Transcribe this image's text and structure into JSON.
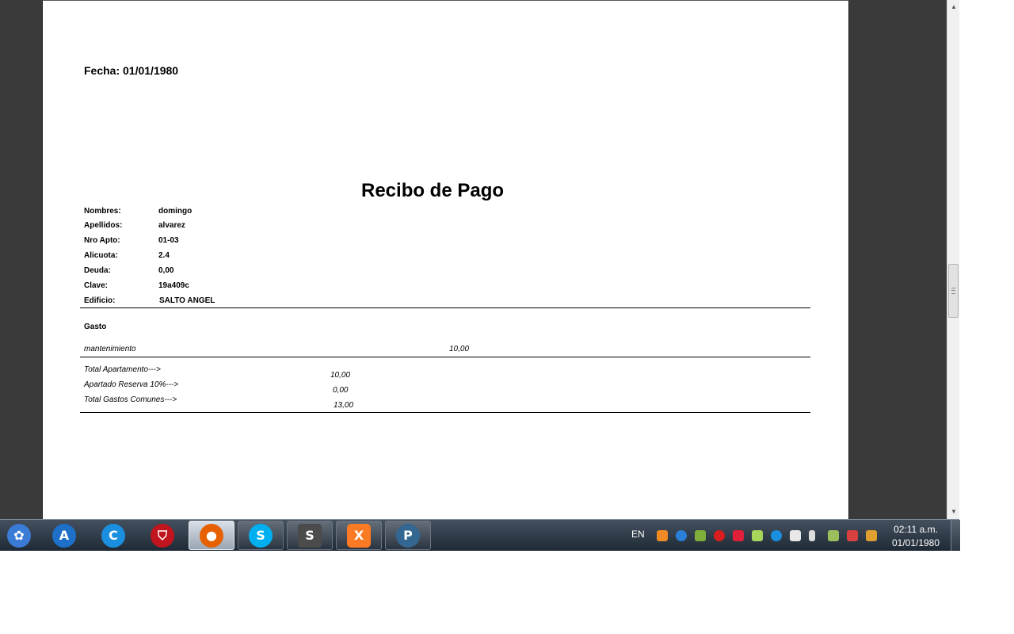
{
  "receipt": {
    "date_line": "Fecha: 01/01/1980",
    "title": "Recibo de Pago",
    "fields": [
      {
        "label": "Nombres:",
        "value": "domingo"
      },
      {
        "label": "Apellidos:",
        "value": "alvarez"
      },
      {
        "label": "Nro Apto:",
        "value": "01-03"
      },
      {
        "label": "Alicuota:",
        "value": "2.4"
      },
      {
        "label": "Deuda:",
        "value": "0,00"
      },
      {
        "label": "Clave:",
        "value": "19a409c"
      },
      {
        "label": "Edificio:",
        "value": "SALTO ANGEL"
      }
    ],
    "gasto_header": "Gasto",
    "gasto_item": {
      "name": "mantenimiento",
      "amount": "10,00"
    },
    "totals": [
      {
        "label": "Total Apartamento--->",
        "value": "10,00"
      },
      {
        "label": "Apartado Reserva 10%--->",
        "value": "0,00"
      },
      {
        "label": "Total Gastos Comunes--->",
        "value": "13,00"
      }
    ]
  },
  "taskbar": {
    "apps": [
      {
        "name": "start",
        "icon": "paint-palette-icon",
        "color": "#3a7bd5"
      },
      {
        "name": "avast",
        "icon": "avast-icon",
        "color": "#1e6fc8"
      },
      {
        "name": "ccleaner",
        "icon": "ccleaner-icon",
        "color": "#1a8fe0"
      },
      {
        "name": "security",
        "icon": "shield-icon",
        "color": "#c0141e"
      },
      {
        "name": "firefox",
        "icon": "firefox-icon",
        "color": "#e66000"
      },
      {
        "name": "skype",
        "icon": "skype-icon",
        "color": "#00aff0"
      },
      {
        "name": "sublime",
        "icon": "sublime-icon",
        "color": "#4b4b4b"
      },
      {
        "name": "xampp",
        "icon": "xampp-icon",
        "color": "#fb7a24"
      },
      {
        "name": "postgres",
        "icon": "postgres-icon",
        "color": "#336791"
      }
    ],
    "language": "EN",
    "clock_time": "02:11 a.m.",
    "clock_date": "01/01/1980"
  }
}
